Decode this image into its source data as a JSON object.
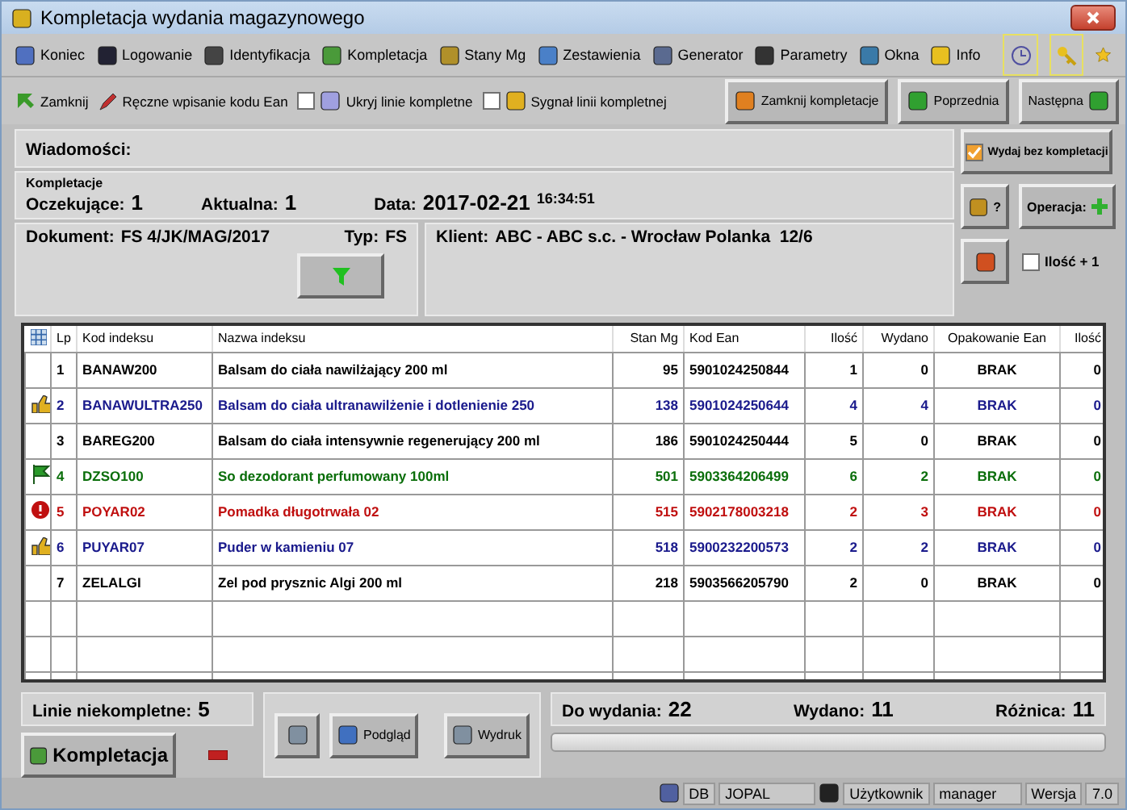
{
  "window": {
    "title": "Kompletacja wydania magazynowego"
  },
  "menu": [
    {
      "label": "Koniec"
    },
    {
      "label": "Logowanie"
    },
    {
      "label": "Identyfikacja"
    },
    {
      "label": "Kompletacja"
    },
    {
      "label": "Stany Mg"
    },
    {
      "label": "Zestawienia"
    },
    {
      "label": "Generator"
    },
    {
      "label": "Parametry"
    },
    {
      "label": "Okna"
    },
    {
      "label": "Info"
    }
  ],
  "toolbar": {
    "close": "Zamknij",
    "manual": "Ręczne wpisanie kodu Ean",
    "checks": [
      {
        "label": "Ukryj linie kompletne",
        "checked": false
      },
      {
        "label": "Sygnał linii kompletnej",
        "checked": false
      }
    ],
    "buttons": [
      "Zamknij kompletacje",
      "Poprzednia",
      "Następna"
    ]
  },
  "messages": {
    "label": "Wiadomości:"
  },
  "session": {
    "caption": "Kompletacje",
    "waiting_label": "Oczekujące:",
    "waiting": "1",
    "current_label": "Aktualna:",
    "current": "1",
    "date_label": "Data:",
    "date": "2017-02-21",
    "time": "16:34:51"
  },
  "document": {
    "label": "Dokument:",
    "value": "FS 4/JK/MAG/2017",
    "type_label": "Typ:",
    "type": "FS"
  },
  "client": {
    "label": "Klient:",
    "value": "ABC - ABC s.c. - Wrocław Polanka  12/6"
  },
  "side": {
    "issue": {
      "label": "Wydaj bez kompletacji",
      "checked": true
    },
    "help": "?",
    "operation": "Operacja:",
    "qty": {
      "label": "Ilość + 1",
      "checked": false
    }
  },
  "table": {
    "columns": [
      "Lp",
      "Kod indeksu",
      "Nazwa indeksu",
      "Stan Mg",
      "Kod Ean",
      "Ilość",
      "Wydano",
      "Opakowanie Ean",
      "Ilość"
    ],
    "rows": [
      {
        "kind": "none",
        "color": "#000000",
        "cells": [
          "1",
          "BANAW200",
          "Balsam do ciała nawilżający 200 ml",
          "95",
          "5901024250844",
          "1",
          "0",
          "BRAK",
          "0"
        ]
      },
      {
        "kind": "thumb",
        "color": "#1a1a8c",
        "cells": [
          "2",
          "BANAWULTRA250",
          "Balsam do ciała ultranawilżenie i dotlenienie 250",
          "138",
          "5901024250644",
          "4",
          "4",
          "BRAK",
          "0"
        ]
      },
      {
        "kind": "none",
        "color": "#000000",
        "cells": [
          "3",
          "BAREG200",
          "Balsam do ciała intensywnie regenerujący 200 ml",
          "186",
          "5901024250444",
          "5",
          "0",
          "BRAK",
          "0"
        ]
      },
      {
        "kind": "flag",
        "color": "#0a6e0a",
        "cells": [
          "4",
          "DZSO100",
          "So dezodorant perfumowany 100ml",
          "501",
          "5903364206499",
          "6",
          "2",
          "BRAK",
          "0"
        ]
      },
      {
        "kind": "alert",
        "color": "#c01010",
        "cells": [
          "5",
          "POYAR02",
          "Pomadka długotrwała 02",
          "515",
          "5902178003218",
          "2",
          "3",
          "BRAK",
          "0"
        ]
      },
      {
        "kind": "thumb",
        "color": "#1a1a8c",
        "cells": [
          "6",
          "PUYAR07",
          "Puder w kamieniu 07",
          "518",
          "5900232200573",
          "2",
          "2",
          "BRAK",
          "0"
        ]
      },
      {
        "kind": "none",
        "color": "#000000",
        "cells": [
          "7",
          "ZELALGI",
          "Zel pod prysznic Algi 200 ml",
          "218",
          "5903566205790",
          "2",
          "0",
          "BRAK",
          "0"
        ]
      }
    ]
  },
  "summary": {
    "incomplete_label": "Linie niekompletne:",
    "incomplete": "5",
    "kompletacja": "Kompletacja",
    "preview": "Podgląd",
    "print": "Wydruk",
    "to_issue_label": "Do wydania:",
    "to_issue": "22",
    "issued_label": "Wydano:",
    "issued": "11",
    "diff_label": "Różnica:",
    "diff": "11",
    "level": 0
  },
  "status_bar": {
    "db": "DB",
    "db_name": "JOPAL",
    "user_label": "Użytkownik",
    "user": "manager",
    "version_label": "Wersja",
    "version": "7.0"
  }
}
